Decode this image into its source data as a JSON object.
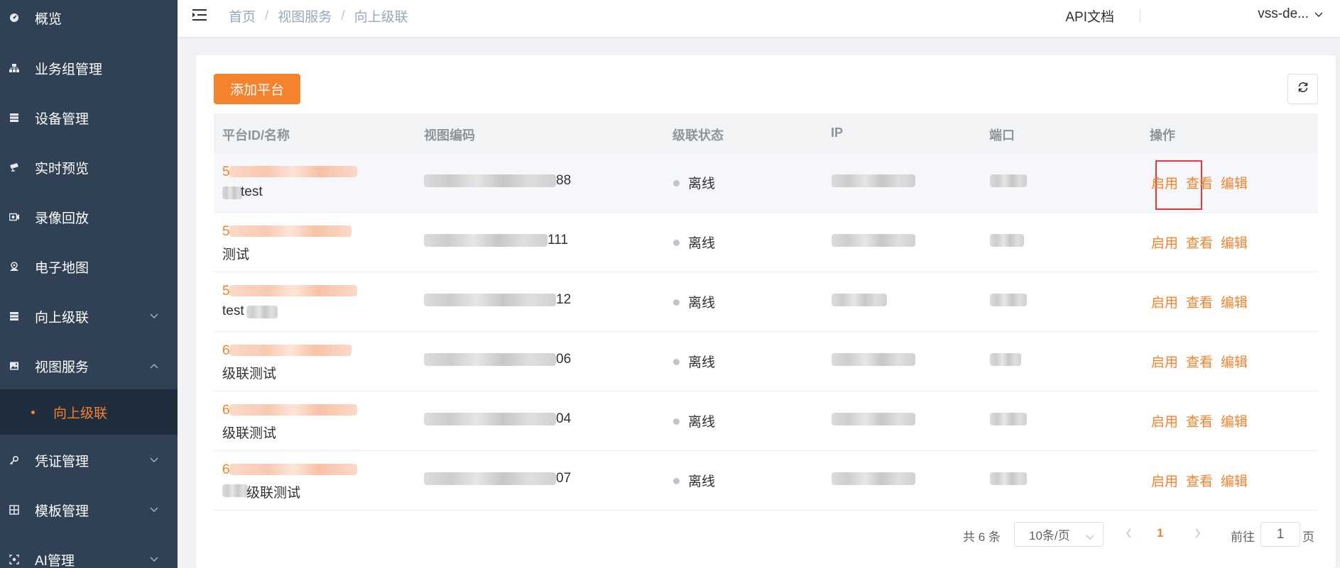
{
  "sidebar": {
    "items": [
      {
        "label": "概览",
        "icon": "dashboard-icon"
      },
      {
        "label": "业务组管理",
        "icon": "org-tree-icon"
      },
      {
        "label": "设备管理",
        "icon": "server-icon"
      },
      {
        "label": "实时预览",
        "icon": "camera-icon"
      },
      {
        "label": "录像回放",
        "icon": "video-playback-icon"
      },
      {
        "label": "电子地图",
        "icon": "map-pin-icon"
      },
      {
        "label": "向上级联",
        "icon": "cascade-icon"
      },
      {
        "label": "视图服务",
        "icon": "image-icon"
      },
      {
        "label": "凭证管理",
        "icon": "key-icon"
      },
      {
        "label": "模板管理",
        "icon": "grid-icon"
      },
      {
        "label": "AI管理",
        "icon": "ai-icon"
      }
    ],
    "active_sub": "向上级联"
  },
  "header": {
    "breadcrumb": [
      "首页",
      "视图服务",
      "向上级联"
    ],
    "api_doc": "API文档",
    "user": "vss-de..."
  },
  "toolbar": {
    "add_label": "添加平台"
  },
  "table": {
    "headers": [
      "平台ID/名称",
      "视图编码",
      "级联状态",
      "IP",
      "端口",
      "操作"
    ],
    "rows": [
      {
        "id_prefix": "5",
        "name": "test",
        "code_suffix": "88",
        "status": "离线"
      },
      {
        "id_prefix": "5",
        "name": "测试",
        "code_suffix": "111",
        "status": "离线"
      },
      {
        "id_prefix": "5",
        "name": "test",
        "code_suffix": "12",
        "status": "离线"
      },
      {
        "id_prefix": "6",
        "name": "级联测试",
        "code_suffix": "06",
        "status": "离线"
      },
      {
        "id_prefix": "6",
        "name": "级联测试",
        "code_suffix": "04",
        "status": "离线"
      },
      {
        "id_prefix": "6",
        "name": "级联测试",
        "code_suffix": "07",
        "status": "离线"
      }
    ],
    "actions": {
      "enable": "启用",
      "view": "查看",
      "edit": "编辑"
    }
  },
  "pagination": {
    "total": "共 6 条",
    "page_size": "10条/页",
    "current_page": "1",
    "goto_label": "前往",
    "goto_value": "1",
    "page_unit": "页"
  },
  "colors": {
    "accent": "#f5822c",
    "sidebar_bg": "#304156",
    "sidebar_active_bg": "#1f2d3d",
    "highlight_box": "#e53935"
  }
}
